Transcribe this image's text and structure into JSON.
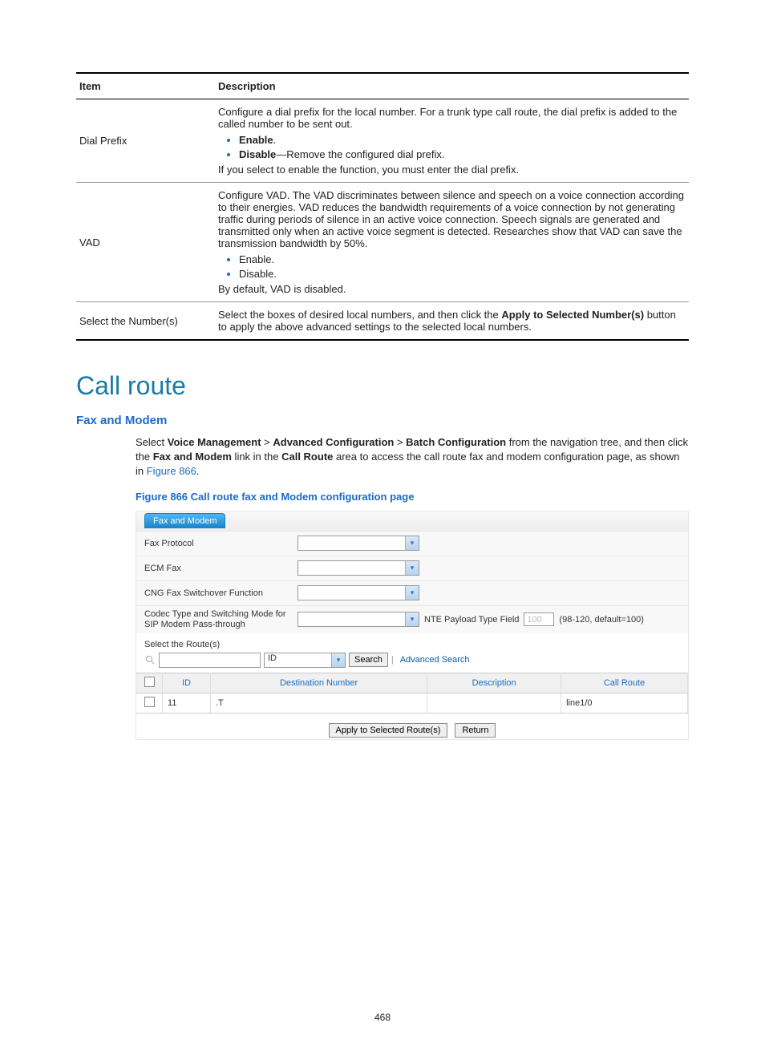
{
  "table": {
    "head_item": "Item",
    "head_desc": "Description",
    "rows": [
      {
        "item": "Dial Prefix",
        "para1": "Configure a dial prefix for the local number. For a trunk type call route, the dial prefix is added to the called number to be sent out.",
        "b1_bold": "Enable",
        "b1_tail": ".",
        "b2_bold": "Disable",
        "b2_tail": "—Remove the configured dial prefix.",
        "para2": "If you select to enable the function, you must enter the dial prefix."
      },
      {
        "item": "VAD",
        "para1": "Configure VAD. The VAD discriminates between silence and speech on a voice connection according to their energies. VAD reduces the bandwidth requirements of a voice connection by not generating traffic during periods of silence in an active voice connection. Speech signals are generated and transmitted only when an active voice segment is detected. Researches show that VAD can save the transmission bandwidth by 50%.",
        "b1": "Enable.",
        "b2": "Disable.",
        "para2": "By default, VAD is disabled."
      },
      {
        "item": "Select the Number(s)",
        "pre": "Select the boxes of desired local numbers, and then click the ",
        "bold": "Apply to Selected Number(s)",
        "post": " button to apply the above advanced settings to the selected local numbers."
      }
    ]
  },
  "section_title": "Call route",
  "sub_title": "Fax and Modem",
  "intro": {
    "pre": "Select ",
    "b1": "Voice Management",
    "s1": " > ",
    "b2": "Advanced Configuration",
    "s2": " > ",
    "b3": "Batch Configuration",
    "mid": " from the navigation tree, and then click the ",
    "b4": "Fax and Modem",
    "mid2": " link in the ",
    "b5": "Call Route",
    "post": " area to access the call route fax and modem configuration page, as shown in ",
    "link": "Figure 866",
    "end": "."
  },
  "fig_caption": "Figure 866 Call route fax and Modem configuration page",
  "cfg": {
    "tab": "Fax and Modem",
    "r1": "Fax Protocol",
    "r2": "ECM Fax",
    "r3": "CNG Fax Switchover Function",
    "r4": "Codec Type and Switching Mode for SIP Modem Pass-through",
    "nte_label": "NTE Payload Type Field",
    "nte_val": "100",
    "nte_hint": "(98-120, default=100)",
    "sel_routes": "Select the Route(s)",
    "search_field": "ID",
    "search_btn": "Search",
    "adv_search": "Advanced Search",
    "th_id": "ID",
    "th_dest": "Destination Number",
    "th_desc": "Description",
    "th_route": "Call Route",
    "row_id": "11",
    "row_dest": ".T",
    "row_desc": "",
    "row_route": "line1/0",
    "btn_apply": "Apply to Selected Route(s)",
    "btn_return": "Return"
  },
  "pagenum": "468"
}
